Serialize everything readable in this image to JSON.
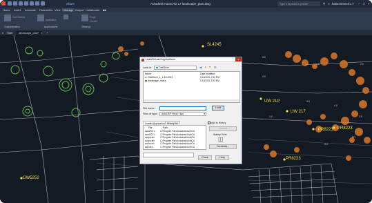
{
  "app": {
    "title": "Autodesk AutoCAD LT   landscape_plan.dwg",
    "share_label": "Share",
    "search_placeholder": "Type a keyword or phrase",
    "user": "katiezimmerb..."
  },
  "menubar": {
    "items": [
      "Home",
      "Insert",
      "Annotate",
      "Parametric",
      "View",
      "Manage",
      "Output",
      "Collaborate",
      "■■"
    ],
    "active": "Manage"
  },
  "ribbon": {
    "panels": [
      "Customization",
      "Applications",
      "Cleanup"
    ],
    "small_labels": [
      "Tool Palettes",
      "Application",
      "Purge",
      "Overkill"
    ]
  },
  "file_tabs": {
    "start": "Start",
    "current": "landscape_plan*",
    "add": "+"
  },
  "drawing": {
    "labels": [
      "SL4245",
      "UW 21P",
      "UW 217",
      "PR8223",
      "PR8223",
      "PR8223",
      "GW5252"
    ],
    "small_labels": [
      "3.0",
      "1.0",
      "2.0",
      "4.0",
      "2.0",
      "1.0",
      "3.5",
      "4.8",
      "2.4",
      "PR"
    ]
  },
  "dialog": {
    "title": "Load/Unload Applications",
    "close": "x",
    "look_in_label": "Look in:",
    "look_in_value": "OneDrive",
    "col_name": "Name",
    "col_date": "Date modified",
    "files": [
      {
        "name": "OneDrive_1_1-15-2021",
        "date": "1/15/2021 2:33 PM"
      },
      {
        "name": "landscape_notes",
        "date": "1/15/2021 2:33 PM"
      }
    ],
    "filename_label": "File name:",
    "filetype_label": "Files of type:",
    "filetype_value": "AutoLISP Files (*.lsp)",
    "load_button": "Load",
    "tabs": [
      "Loaded Applications",
      "History list"
    ],
    "add_to_history": "Add to History",
    "table_headers": [
      "File",
      "Path"
    ],
    "rows": [
      {
        "file": "acad2021...",
        "path": "C:\\Program Files\\Autodesk\\AutoCA"
      },
      {
        "file": "acad2021...",
        "path": "C:\\Program Files\\Autodesk\\AutoCA"
      },
      {
        "file": "acapp.arx",
        "path": "C:\\Program Files\\Autodesk\\AutoCA"
      },
      {
        "file": "acapp.arx",
        "path": "C:\\Program Files\\Autodesk\\AutoCA"
      },
      {
        "file": "acdim.arx",
        "path": "C:\\Program Files\\Autodesk\\AutoCA"
      },
      {
        "file": "achlnkd...",
        "path": "C:\\Program Files\\Autodesk\\AutoCA"
      }
    ],
    "unload_button": "Unload",
    "startup_suite_label": "Startup Suite",
    "contents_button": "Contents...",
    "close_button": "Close",
    "help_button": "Help"
  },
  "colors": {
    "background": "#141a23",
    "labels": "#f2e04a",
    "trees": "#d8772a",
    "circles": "#5fc050",
    "lines": "#c9d1dc"
  }
}
